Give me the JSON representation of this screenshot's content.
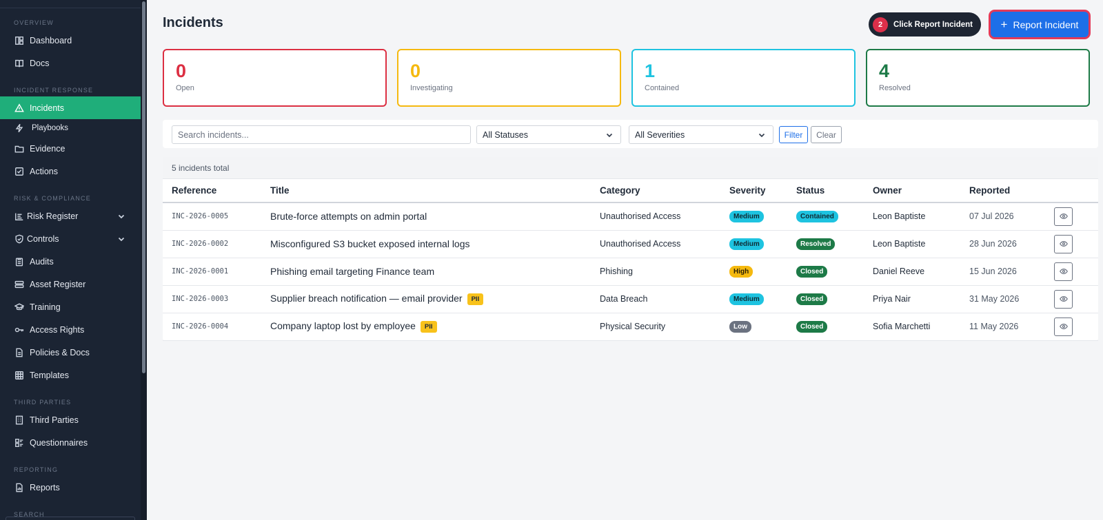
{
  "sidebar": {
    "sections": {
      "overview": "Overview",
      "incident_response": "Incident Response",
      "risk_compliance": "Risk & Compliance",
      "third_parties": "Third Parties",
      "reporting": "Reporting",
      "search": "Search"
    },
    "items": {
      "dashboard": "Dashboard",
      "docs": "Docs",
      "incidents": "Incidents",
      "playbooks": "Playbooks",
      "evidence": "Evidence",
      "actions": "Actions",
      "risk_register": "Risk Register",
      "controls": "Controls",
      "audits": "Audits",
      "asset_register": "Asset Register",
      "training": "Training",
      "access_rights": "Access Rights",
      "policies_docs": "Policies & Docs",
      "templates": "Templates",
      "third_parties": "Third Parties",
      "questionnaires": "Questionnaires",
      "reports": "Reports"
    },
    "active": "incidents"
  },
  "header": {
    "title": "Incidents",
    "tooltip_step": "2",
    "tooltip_text": "Click Report Incident",
    "report_button": "Report Incident"
  },
  "stats": [
    {
      "value": "0",
      "label": "Open",
      "color": "#dc2f42"
    },
    {
      "value": "0",
      "label": "Investigating",
      "color": "#f5b90f"
    },
    {
      "value": "1",
      "label": "Contained",
      "color": "#1ec3e0"
    },
    {
      "value": "4",
      "label": "Resolved",
      "color": "#1d7a47"
    }
  ],
  "filters": {
    "search_placeholder": "Search incidents...",
    "status_value": "All Statuses",
    "severity_value": "All Severities",
    "filter_button": "Filter",
    "clear_button": "Clear"
  },
  "table": {
    "count_text": "5 incidents total",
    "columns": [
      "Reference",
      "Title",
      "Category",
      "Severity",
      "Status",
      "Owner",
      "Reported"
    ],
    "rows": [
      {
        "ref": "INC-2026-0005",
        "title": "Brute-force attempts on admin portal",
        "pii": "",
        "category": "Unauthorised Access",
        "severity": "Medium",
        "status": "Contained",
        "owner": "Leon Baptiste",
        "reported": "07 Jul 2026"
      },
      {
        "ref": "INC-2026-0002",
        "title": "Misconfigured S3 bucket exposed internal logs",
        "pii": "",
        "category": "Unauthorised Access",
        "severity": "Medium",
        "status": "Resolved",
        "owner": "Leon Baptiste",
        "reported": "28 Jun 2026"
      },
      {
        "ref": "INC-2026-0001",
        "title": "Phishing email targeting Finance team",
        "pii": "",
        "category": "Phishing",
        "severity": "High",
        "status": "Closed",
        "owner": "Daniel Reeve",
        "reported": "15 Jun 2026"
      },
      {
        "ref": "INC-2026-0003",
        "title": "Supplier breach notification — email provider",
        "pii": "PII",
        "category": "Data Breach",
        "severity": "Medium",
        "status": "Closed",
        "owner": "Priya Nair",
        "reported": "31 May 2026"
      },
      {
        "ref": "INC-2026-0004",
        "title": "Company laptop lost by employee",
        "pii": "PII",
        "category": "Physical Security",
        "severity": "Low",
        "status": "Closed",
        "owner": "Sofia Marchetti",
        "reported": "11 May 2026"
      }
    ]
  },
  "colors": {
    "severity": {
      "Medium": "#1ec3e0",
      "High": "#f5b90f",
      "Low": "#6b7280"
    },
    "severity_text": {
      "Medium": "#0f2a33",
      "High": "#2a2005",
      "Low": "#ffffff"
    },
    "status": {
      "Contained": "#1ec3e0",
      "Resolved": "#1d7a47",
      "Closed": "#1d7a47"
    },
    "status_text": {
      "Contained": "#0f2a33",
      "Resolved": "#ffffff",
      "Closed": "#ffffff"
    }
  }
}
